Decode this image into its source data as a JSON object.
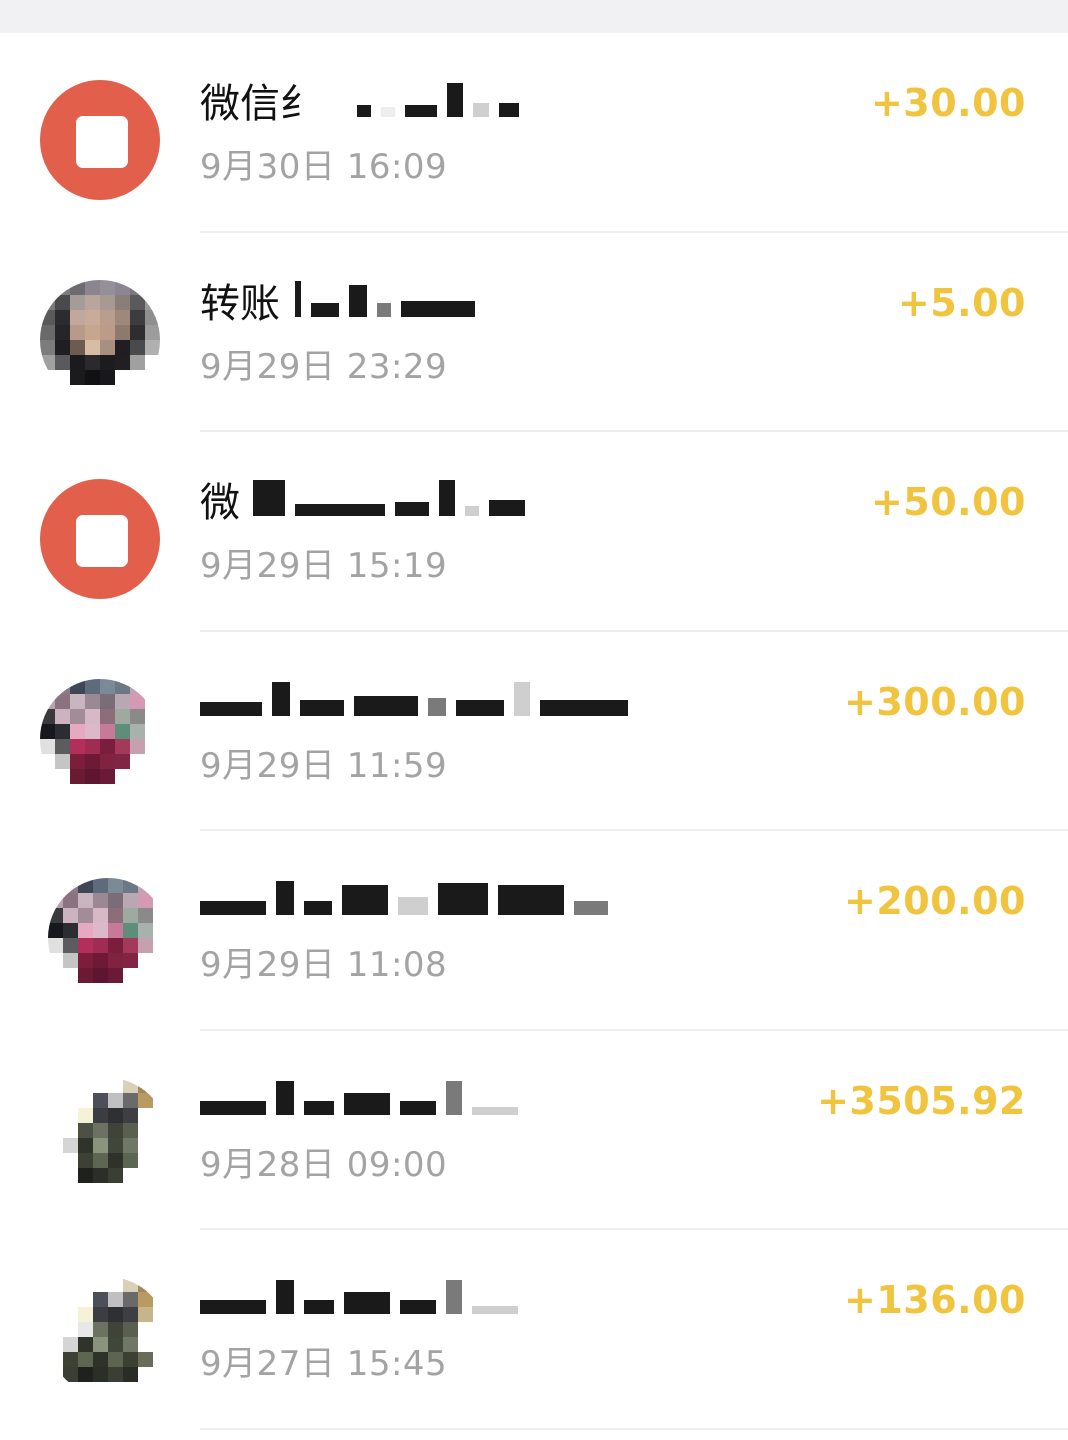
{
  "transactions": [
    {
      "title": "微信纟",
      "time": "9月30日 16:09",
      "amount": "+30.00",
      "avatar": "wechat-pay-icon"
    },
    {
      "title": "转账",
      "time": "9月29日 23:29",
      "amount": "+5.00",
      "avatar": "user-photo"
    },
    {
      "title": "微",
      "time": "9月29日 15:19",
      "amount": "+50.00",
      "avatar": "wechat-pay-icon"
    },
    {
      "title": "",
      "time": "9月29日 11:59",
      "amount": "+300.00",
      "avatar": "user-photo"
    },
    {
      "title": "",
      "time": "9月29日 11:08",
      "amount": "+200.00",
      "avatar": "user-photo"
    },
    {
      "title": "",
      "time": "9月28日 09:00",
      "amount": "+3505.92",
      "avatar": "user-photo"
    },
    {
      "title": "",
      "time": "9月27日 15:45",
      "amount": "+136.00",
      "avatar": "user-photo"
    }
  ],
  "colors": {
    "amount": "#f0c43f",
    "wechat_pay_red": "#e25f4c",
    "time_gray": "#a3a3a3"
  }
}
